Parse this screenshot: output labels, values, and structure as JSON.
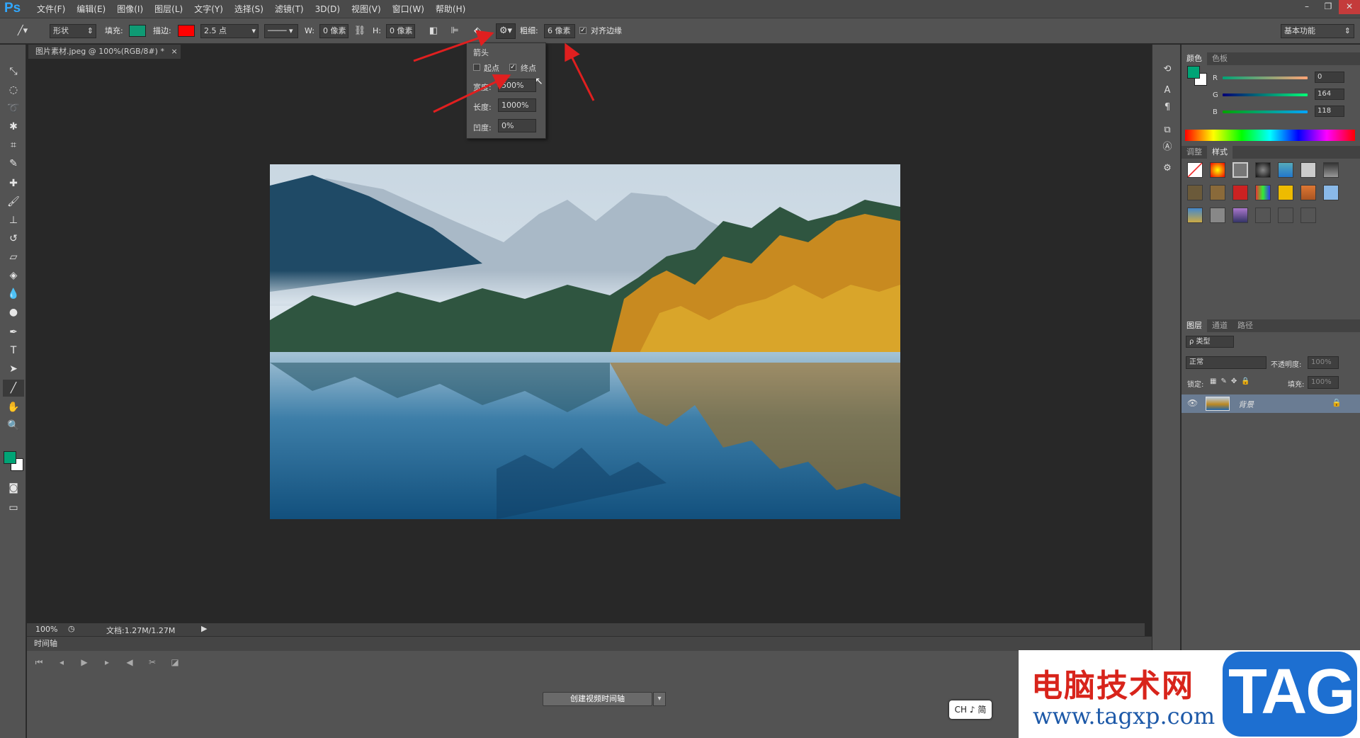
{
  "app": {
    "logo": "Ps"
  },
  "menu": [
    "文件(F)",
    "编辑(E)",
    "图像(I)",
    "图层(L)",
    "文字(Y)",
    "选择(S)",
    "滤镜(T)",
    "3D(D)",
    "视图(V)",
    "窗口(W)",
    "帮助(H)"
  ],
  "window_controls": {
    "minimize": "–",
    "restore": "❐",
    "close": "✕"
  },
  "options_bar": {
    "mode_value": "形状",
    "fill_label": "填充:",
    "fill_color": "#0f9a74",
    "stroke_label": "描边:",
    "stroke_color": "#ff0000",
    "stroke_width": "2.5 点",
    "w_label": "W:",
    "w_value": "0 像素",
    "h_label": "H:",
    "h_value": "0 像素",
    "weight_label": "粗细:",
    "weight_value": "6 像素",
    "align_edges_label": "对齐边缘",
    "align_edges_checked": true,
    "workspace": "基本功能"
  },
  "arrow_popup": {
    "title": "箭头",
    "start_label": "起点",
    "start_checked": false,
    "end_label": "终点",
    "end_checked": true,
    "width_label": "宽度:",
    "width_value": "500%",
    "length_label": "长度:",
    "length_value": "1000%",
    "concavity_label": "凹度:",
    "concavity_value": "0%"
  },
  "document": {
    "tab_title": "图片素材.jpeg @ 100%(RGB/8#) *",
    "tab_close": "×"
  },
  "status": {
    "zoom": "100%",
    "doc_info": "文档:1.27M/1.27M"
  },
  "timeline": {
    "title": "时间轴",
    "create_button": "创建视频时间轴"
  },
  "ime": {
    "text": "CH ♪ 简"
  },
  "color_panel": {
    "tabs": [
      "颜色",
      "色板"
    ],
    "fg_color": "#00a476",
    "r_label": "R",
    "r_value": "0",
    "g_label": "G",
    "g_value": "164",
    "b_label": "B",
    "b_value": "118"
  },
  "adjust_panel": {
    "tabs": [
      "调整",
      "样式"
    ]
  },
  "layers_panel": {
    "tabs": [
      "图层",
      "通道",
      "路径"
    ],
    "filter_kind": "ρ 类型",
    "blend_mode": "正常",
    "opacity_label": "不透明度:",
    "opacity_value": "100%",
    "lock_label": "锁定:",
    "fill_label": "填充:",
    "fill_value": "100%",
    "layer_name": "背景"
  },
  "watermark": {
    "cn": "电脑技术网",
    "url": "www.tagxp.com",
    "tag": "TAG"
  }
}
